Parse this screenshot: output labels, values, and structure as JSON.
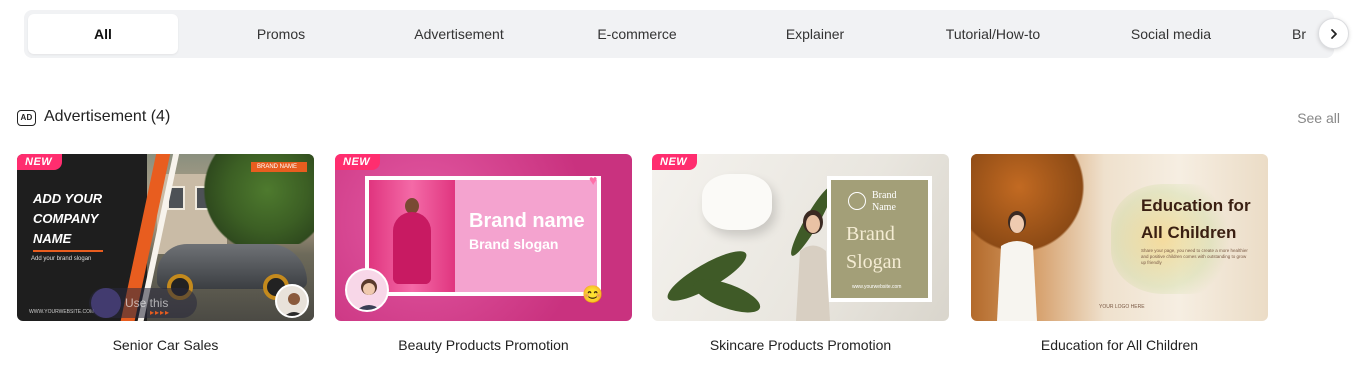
{
  "tabs": [
    {
      "label": "All",
      "active": true
    },
    {
      "label": "Promos",
      "active": false
    },
    {
      "label": "Advertisement",
      "active": false
    },
    {
      "label": "E-commerce",
      "active": false
    },
    {
      "label": "Explainer",
      "active": false
    },
    {
      "label": "Tutorial/How-to",
      "active": false
    },
    {
      "label": "Social media",
      "active": false
    },
    {
      "label": "Br",
      "active": false
    }
  ],
  "tabs_next_icon": "chevron-right-icon",
  "section": {
    "icon_text": "AD",
    "title": "Advertisement (4)",
    "see_all": "See all"
  },
  "new_badge": "NEW",
  "cards": [
    {
      "title": "Senior Car Sales",
      "is_new": true,
      "thumb": {
        "headline_1": "ADD YOUR",
        "headline_2": "COMPANY",
        "headline_3": "NAME",
        "sub": "Add your brand slogan",
        "website": "WWW.YOURWEBSITE.COM",
        "brand_tag": "BRAND NAME",
        "hover_button": "Use this template",
        "arrows": "▸▸▸▸"
      }
    },
    {
      "title": "Beauty Products Promotion",
      "is_new": true,
      "thumb": {
        "brand_name": "Brand name",
        "brand_slogan": "Brand slogan",
        "emoji": "😊",
        "heart": "♥"
      }
    },
    {
      "title": "Skincare Products Promotion",
      "is_new": true,
      "thumb": {
        "brand_name_1": "Brand",
        "brand_name_2": "Name",
        "slogan_1": "Brand",
        "slogan_2": "Slogan",
        "url": "www.yourwebsite.com"
      }
    },
    {
      "title": "Education for All Children",
      "is_new": false,
      "thumb": {
        "headline_1": "Education for",
        "headline_2": "All Children",
        "desc": "Share your page, you need to create a more healthier and positive children comes with outstanding to grow up friendly",
        "logo": "YOUR LOGO HERE"
      }
    }
  ],
  "colors": {
    "tab_bar_bg": "#f1f2f4",
    "new_badge": "#ff2d6f",
    "accent_orange": "#e85d1f"
  }
}
